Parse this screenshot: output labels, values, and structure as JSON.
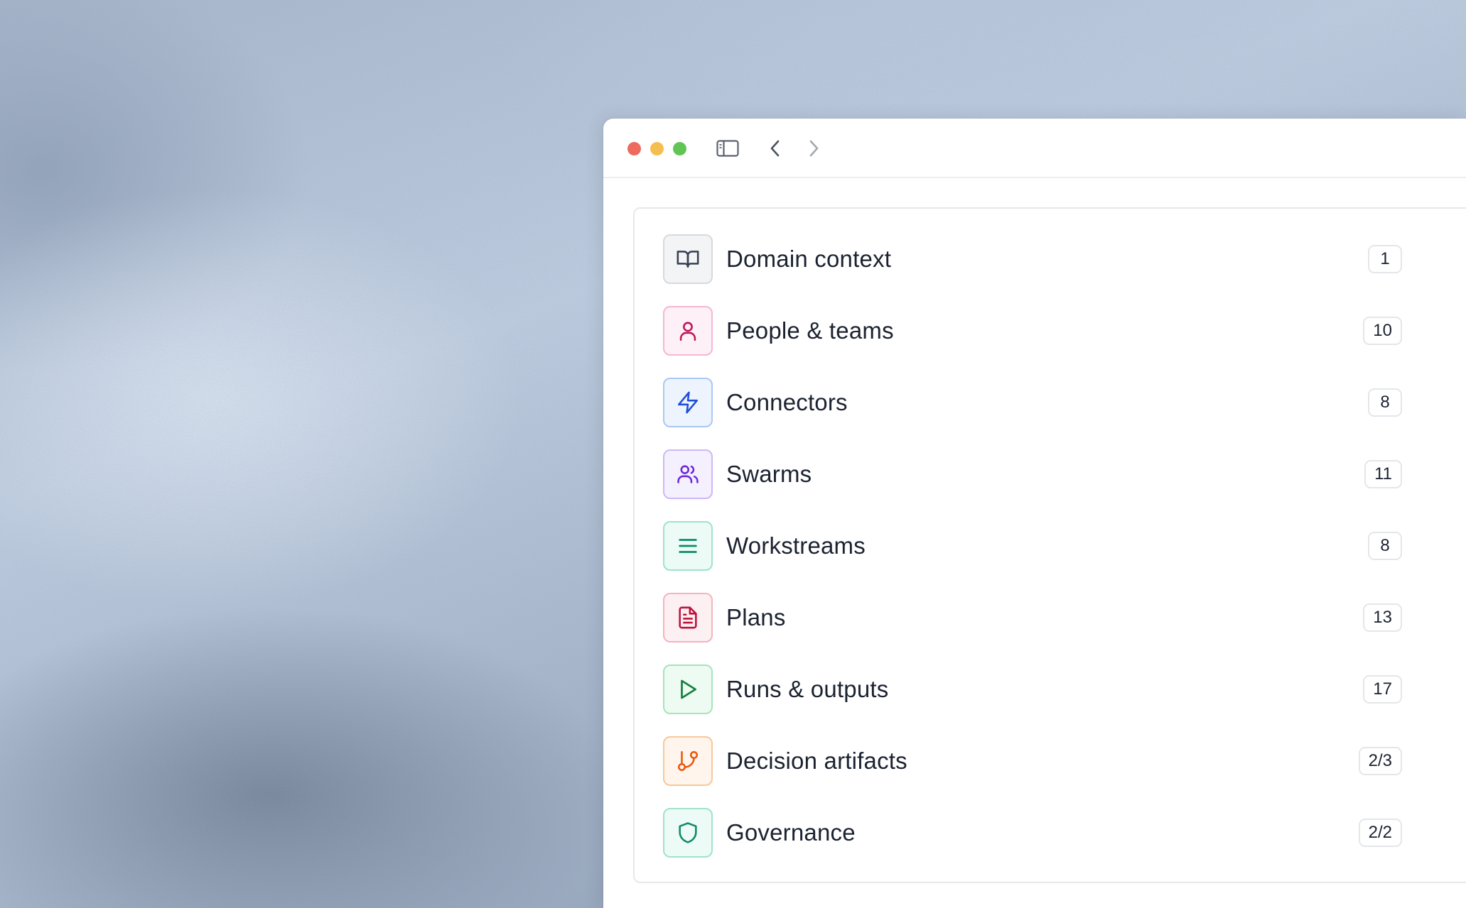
{
  "window": {
    "toolbar": {
      "sidebar_icon": "sidebar-toggle-icon",
      "back_icon": "chevron-left-icon",
      "forward_icon": "chevron-right-icon"
    }
  },
  "items": [
    {
      "label": "Domain context",
      "count": "1",
      "icon": "book-open-icon",
      "color": "#374151",
      "bg": "#f3f4f6",
      "border": "#d6d9de"
    },
    {
      "label": "People & teams",
      "count": "10",
      "icon": "user-icon",
      "color": "#be185d",
      "bg": "#fdf0f6",
      "border": "#f6b6d3"
    },
    {
      "label": "Connectors",
      "count": "8",
      "icon": "lightning-icon",
      "color": "#1d4ed8",
      "bg": "#eef4fe",
      "border": "#a9c8f5"
    },
    {
      "label": "Swarms",
      "count": "11",
      "icon": "users-icon",
      "color": "#6d28d9",
      "bg": "#f4f0fe",
      "border": "#cdb8f7"
    },
    {
      "label": "Workstreams",
      "count": "8",
      "icon": "list-icon",
      "color": "#0f8a6a",
      "bg": "#ecfbf5",
      "border": "#9fe3c8"
    },
    {
      "label": "Plans",
      "count": "13",
      "icon": "document-icon",
      "color": "#be123c",
      "bg": "#fdf0f2",
      "border": "#f5b3bf"
    },
    {
      "label": "Runs & outputs",
      "count": "17",
      "icon": "play-icon",
      "color": "#15803d",
      "bg": "#eefbf2",
      "border": "#a6e4bb"
    },
    {
      "label": "Decision artifacts",
      "count": "2/3",
      "icon": "git-branch-icon",
      "color": "#ea580c",
      "bg": "#fff5ec",
      "border": "#f9c79a"
    },
    {
      "label": "Governance",
      "count": "2/2",
      "icon": "shield-icon",
      "color": "#0f8a6a",
      "bg": "#ecfbf5",
      "border": "#9fe3c8"
    }
  ]
}
